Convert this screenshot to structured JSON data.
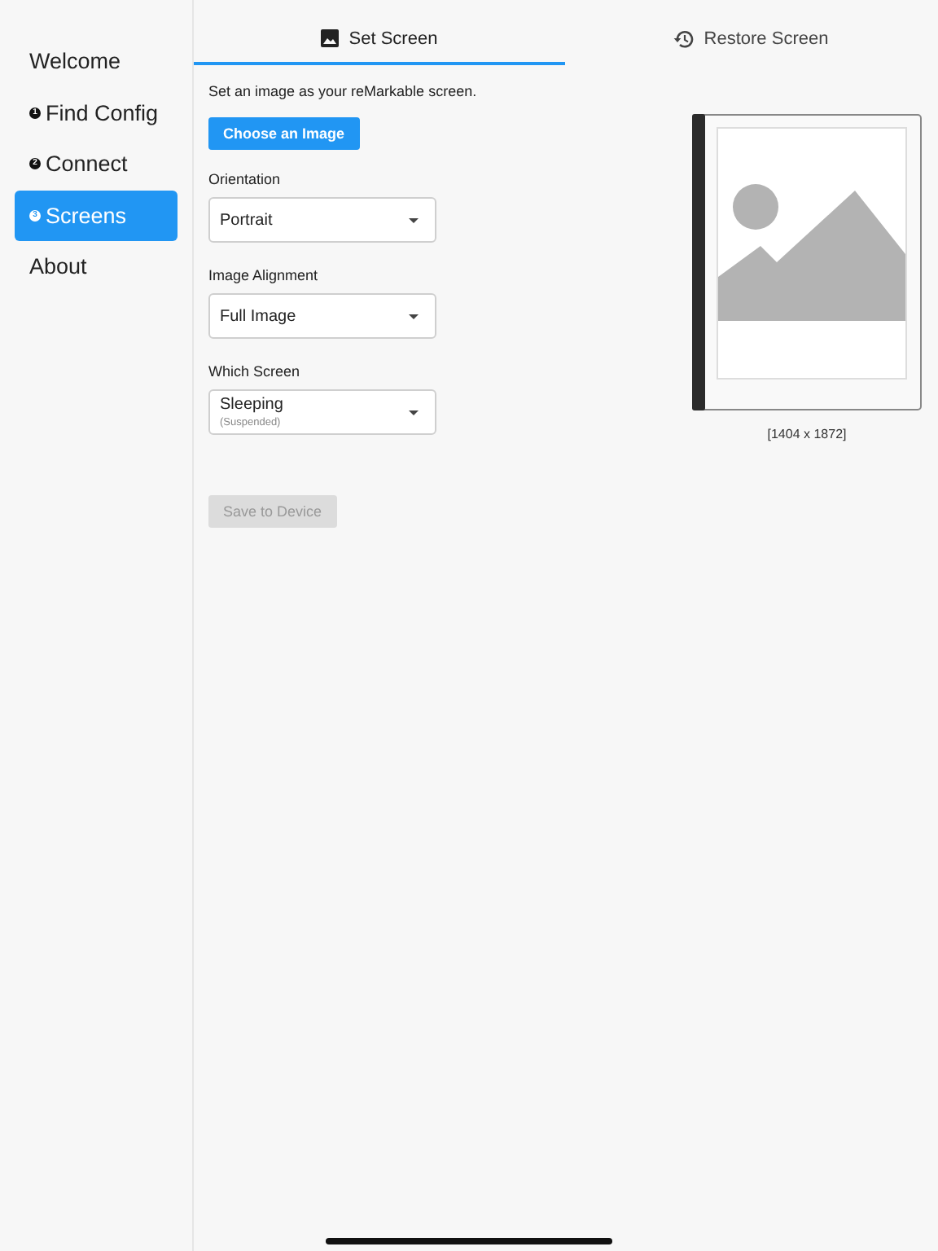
{
  "sidebar": {
    "items": [
      {
        "label": "Welcome",
        "selected": false
      },
      {
        "label": "Find Config",
        "badge": "1",
        "selected": false
      },
      {
        "label": "Connect",
        "badge": "2",
        "selected": false
      },
      {
        "label": "Screens",
        "badge": "3",
        "selected": true
      },
      {
        "label": "About",
        "selected": false
      }
    ]
  },
  "tabs": [
    {
      "label": "Set Screen",
      "kind": "image",
      "selected": true
    },
    {
      "label": "Restore Screen",
      "kind": "history",
      "selected": false
    }
  ],
  "form": {
    "intro": "Set an image as your reMarkable screen.",
    "choose_button": "Choose an Image",
    "fields": [
      {
        "label": "Orientation",
        "value": "Portrait"
      },
      {
        "label": "Image Alignment",
        "value": "Full Image"
      },
      {
        "label": "Which Screen",
        "value": "Sleeping",
        "subtitle": "(Suspended)"
      }
    ],
    "save_button": {
      "label": "Save to Device",
      "disabled": true
    }
  },
  "preview": {
    "caption": "[1404 x 1872]"
  }
}
